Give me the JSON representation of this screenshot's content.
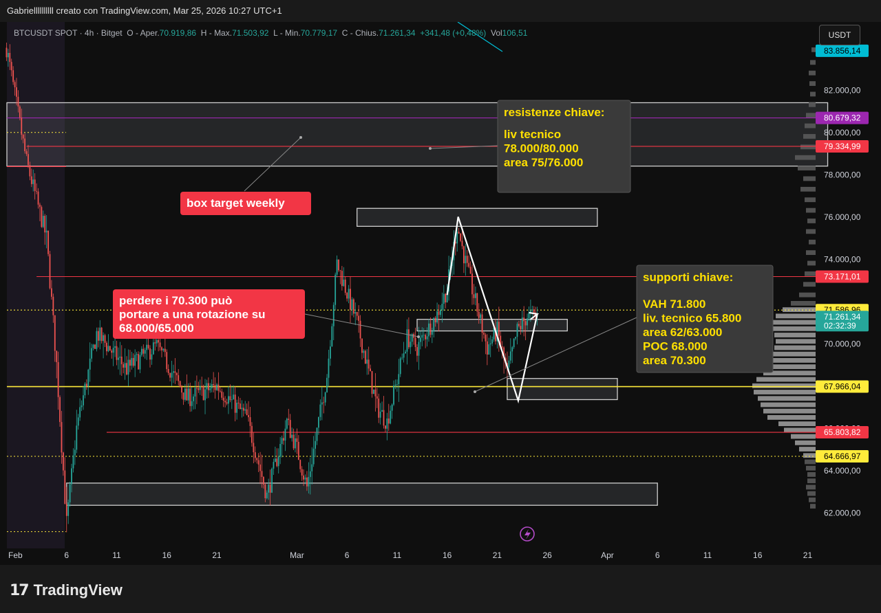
{
  "header": {
    "caption": "Gabriellllllllll creato con TradingView.com, Mar 25, 2026 10:27 UTC+1"
  },
  "legend": {
    "symbol": "BTCUSDT SPOT · 4h · Bitget",
    "open_label": "O - Aper.",
    "open": "70.919,86",
    "high_label": "H - Max.",
    "high": "71.503,92",
    "low_label": "L - Min.",
    "low": "70.779,17",
    "close_label": "C - Chius.",
    "close": "71.261,34",
    "change": "+341,48 (+0,48%)",
    "vol_label": "Vol",
    "vol": "106,51"
  },
  "currency_button": "USDT",
  "footer": {
    "brand": "TradingView"
  },
  "colors": {
    "up": "#26a69a",
    "down": "#ef5350",
    "cyan": "#00bcd4",
    "magenta": "#9c27b0",
    "red_line": "#f23645",
    "yellow": "#ffeb3b",
    "annotation_red": "#f23645",
    "annotation_grey": "#3a3a3a",
    "annotation_yellow_text": "#ffe000"
  },
  "chart_data": {
    "type": "candlestick",
    "ylim": [
      60500,
      85200
    ],
    "y_ticks": [
      {
        "value": 82000,
        "label": "82.000,00"
      },
      {
        "value": 80000,
        "label": "80.000,00"
      },
      {
        "value": 78000,
        "label": "78.000,00"
      },
      {
        "value": 76000,
        "label": "76.000,00"
      },
      {
        "value": 74000,
        "label": "74.000,00"
      },
      {
        "value": 70000,
        "label": "70.000,00"
      },
      {
        "value": 66000,
        "label": "66.000,00"
      },
      {
        "value": 64000,
        "label": "64.000,00"
      },
      {
        "value": 62000,
        "label": "62.000,00"
      }
    ],
    "x_ticks": [
      {
        "date": "2026-02-01",
        "label": "Feb"
      },
      {
        "date": "2026-02-06",
        "label": "6"
      },
      {
        "date": "2026-02-11",
        "label": "11"
      },
      {
        "date": "2026-02-16",
        "label": "16"
      },
      {
        "date": "2026-02-21",
        "label": "21"
      },
      {
        "date": "2026-03-01",
        "label": "Mar"
      },
      {
        "date": "2026-03-06",
        "label": "6"
      },
      {
        "date": "2026-03-11",
        "label": "11"
      },
      {
        "date": "2026-03-16",
        "label": "16"
      },
      {
        "date": "2026-03-21",
        "label": "21"
      },
      {
        "date": "2026-03-26",
        "label": "26"
      },
      {
        "date": "2026-04-01",
        "label": "Apr"
      },
      {
        "date": "2026-04-06",
        "label": "6"
      },
      {
        "date": "2026-04-11",
        "label": "11"
      },
      {
        "date": "2026-04-16",
        "label": "16"
      },
      {
        "date": "2026-04-21",
        "label": "21"
      }
    ],
    "price_tags": [
      {
        "value": 83856.14,
        "label": "83.856,14",
        "color": "#00bcd4",
        "text_color": "#000000"
      },
      {
        "value": 80679.32,
        "label": "80.679,32",
        "color": "#9c27b0",
        "text_color": "#ffffff"
      },
      {
        "value": 79334.99,
        "label": "79.334,99",
        "color": "#f23645",
        "text_color": "#ffffff"
      },
      {
        "value": 73171.01,
        "label": "73.171,01",
        "color": "#f23645",
        "text_color": "#ffffff"
      },
      {
        "value": 71586.96,
        "label": "71.586,96",
        "color": "#ffeb3b",
        "text_color": "#000000"
      },
      {
        "value": 71261.34,
        "label": "71.261,34",
        "sublabel": "02:32:39",
        "color": "#26a69a",
        "text_color": "#ffffff"
      },
      {
        "value": 67966.04,
        "label": "67.966,04",
        "color": "#ffeb3b",
        "text_color": "#000000"
      },
      {
        "value": 65803.82,
        "label": "65.803,82",
        "color": "#f23645",
        "text_color": "#ffffff"
      },
      {
        "value": 64666.97,
        "label": "64.666,97",
        "color": "#ffeb3b",
        "text_color": "#000000"
      }
    ],
    "horizontal_lines": [
      {
        "value": 80679.32,
        "style": "solid",
        "color": "#9c27b0"
      },
      {
        "value": 79334.99,
        "style": "solid",
        "color": "#f23645",
        "from": "2026-02-02"
      },
      {
        "value": 73171.01,
        "style": "solid",
        "color": "#f23645",
        "from": "2026-02-03"
      },
      {
        "value": 71586.96,
        "style": "dotted",
        "color": "#ffeb3b"
      },
      {
        "value": 67966.04,
        "style": "solid",
        "color": "#ffeb3b"
      },
      {
        "value": 65803.82,
        "style": "solid",
        "color": "#f23645",
        "from": "2026-02-10"
      },
      {
        "value": 64666.97,
        "style": "dotted",
        "color": "#ffeb3b"
      }
    ],
    "zones": [
      {
        "x0": "2026-01-31",
        "x1": "2026-04-23",
        "y0": 78400,
        "y1": 81400,
        "name": "box target weekly"
      },
      {
        "x0": "2026-03-07",
        "x1": "2026-03-31",
        "y0": 75550,
        "y1": 76400
      },
      {
        "x0": "2026-03-13",
        "x1": "2026-03-28",
        "y0": 70600,
        "y1": 71150
      },
      {
        "x0": "2026-03-22",
        "x1": "2026-04-02",
        "y0": 67350,
        "y1": 68350
      },
      {
        "x0": "2026-02-06",
        "x1": "2026-04-06",
        "y0": 62350,
        "y1": 63400
      }
    ],
    "projection": [
      {
        "date": "2026-03-16.0",
        "value": 72300
      },
      {
        "date": "2026-03-17.1",
        "value": 76000
      },
      {
        "date": "2026-03-23.1",
        "value": 67300
      },
      {
        "date": "2026-03-25.0",
        "value": 71400
      }
    ],
    "annotations": [
      {
        "text": "box target weekly",
        "style": "red"
      },
      {
        "text": "perdere i 70.300 può portare a una rotazione su 68.000/65.000",
        "style": "red"
      },
      {
        "title": "resistenze chiave:",
        "lines": [
          "liv tecnico",
          "78.000/80.000",
          "area 75/76.000"
        ],
        "style": "grey"
      },
      {
        "title": "supporti chiave:",
        "lines": [
          "VAH 71.800",
          "liv. tecnico 65.800",
          "area 62/63.000",
          "POC 68.000",
          "area 70.300"
        ],
        "style": "grey"
      }
    ],
    "series_anchor": [
      {
        "date": "2026-01-31",
        "value": 84000
      },
      {
        "date": "2026-02-02",
        "value": 78600
      },
      {
        "date": "2026-02-04",
        "value": 75000
      },
      {
        "date": "2026-02-05",
        "value": 69000
      },
      {
        "date": "2026-02-06",
        "value": 61500
      },
      {
        "date": "2026-02-07",
        "value": 66000
      },
      {
        "date": "2026-02-09",
        "value": 70500
      },
      {
        "date": "2026-02-12",
        "value": 68800
      },
      {
        "date": "2026-02-15",
        "value": 69900
      },
      {
        "date": "2026-02-18",
        "value": 67400
      },
      {
        "date": "2026-02-21",
        "value": 68000
      },
      {
        "date": "2026-02-24",
        "value": 66500
      },
      {
        "date": "2026-02-26",
        "value": 62800
      },
      {
        "date": "2026-02-28",
        "value": 66300
      },
      {
        "date": "2026-03-01",
        "value": 65000
      },
      {
        "date": "2026-03-02",
        "value": 63200
      },
      {
        "date": "2026-03-04",
        "value": 68500
      },
      {
        "date": "2026-03-05",
        "value": 73800
      },
      {
        "date": "2026-03-07",
        "value": 71000
      },
      {
        "date": "2026-03-09",
        "value": 67000
      },
      {
        "date": "2026-03-10",
        "value": 66300
      },
      {
        "date": "2026-03-12",
        "value": 70300
      },
      {
        "date": "2026-03-13",
        "value": 69800
      },
      {
        "date": "2026-03-15",
        "value": 71400
      },
      {
        "date": "2026-03-16",
        "value": 72600
      },
      {
        "date": "2026-03-17",
        "value": 75600
      },
      {
        "date": "2026-03-18",
        "value": 73500
      },
      {
        "date": "2026-03-20",
        "value": 69800
      },
      {
        "date": "2026-03-21",
        "value": 70600
      },
      {
        "date": "2026-03-22",
        "value": 68600
      },
      {
        "date": "2026-03-23",
        "value": 70600
      },
      {
        "date": "2026-03-24",
        "value": 71300
      },
      {
        "date": "2026-03-25",
        "value": 71261
      }
    ]
  }
}
